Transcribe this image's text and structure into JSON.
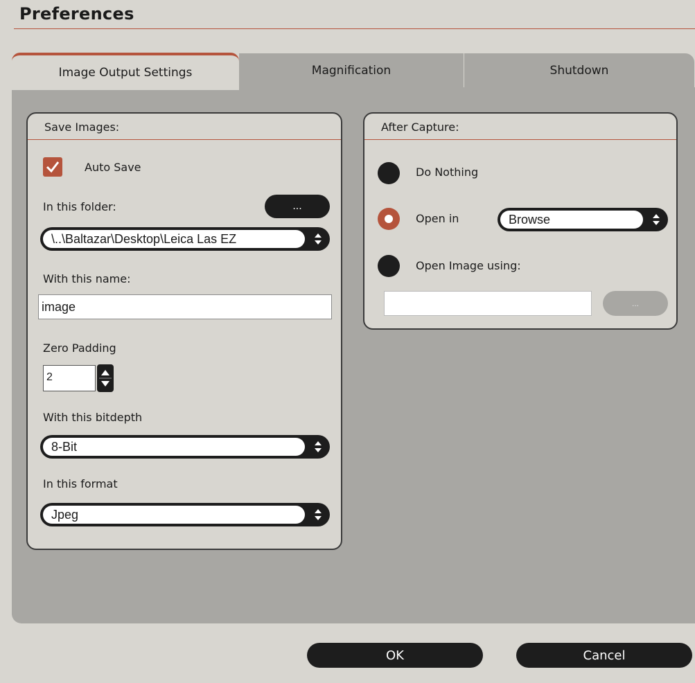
{
  "window": {
    "title": "Preferences"
  },
  "tabs": [
    {
      "label": "Image Output Settings",
      "active": true
    },
    {
      "label": "Magnification",
      "active": false
    },
    {
      "label": "Shutdown",
      "active": false
    }
  ],
  "save_images": {
    "title": "Save Images:",
    "auto_save": {
      "label": "Auto Save",
      "checked": true
    },
    "folder_label": "In this folder:",
    "browse_label": "...",
    "folder_value": "\\..\\Baltazar\\Desktop\\Leica Las EZ",
    "name_label": "With this name:",
    "name_value": "image",
    "padding_label": "Zero Padding",
    "padding_value": "2",
    "bitdepth_label": "With this bitdepth",
    "bitdepth_value": "8-Bit",
    "format_label": "In this format",
    "format_value": "Jpeg"
  },
  "after_capture": {
    "title": "After Capture:",
    "do_nothing_label": "Do Nothing",
    "open_in_label": "Open in",
    "open_in_value": "Browse",
    "open_using_label": "Open Image using:",
    "open_using_value": "",
    "open_using_browse_label": "...",
    "selected": "open_in"
  },
  "buttons": {
    "ok": "OK",
    "cancel": "Cancel"
  },
  "colors": {
    "accent": "#b5543c",
    "dark": "#1d1d1d",
    "panel": "#a8a7a3",
    "background": "#d8d6d0"
  }
}
